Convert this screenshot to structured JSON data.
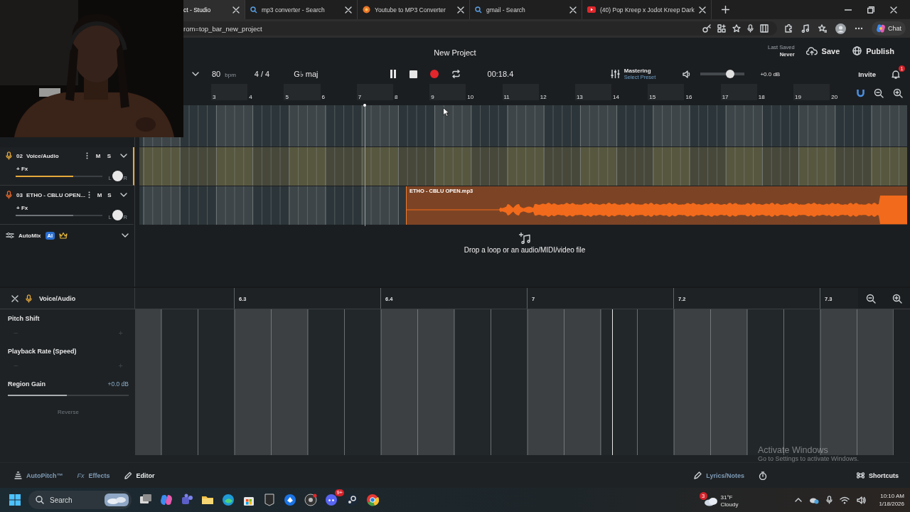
{
  "browser": {
    "tabs": [
      {
        "title": "ct - Studio",
        "selected": true
      },
      {
        "title": "mp3 converter - Search",
        "kind": "search",
        "selected": false
      },
      {
        "title": "Youtube to MP3 Converter",
        "kind": "converter",
        "selected": false
      },
      {
        "title": "gmail - Search",
        "kind": "search",
        "selected": false
      },
      {
        "title": "(40) Pop Kreep x Jodot Kreep Dark",
        "kind": "video",
        "selected": false
      }
    ],
    "address": "rom=top_bar_new_project",
    "chat_button": "Chat"
  },
  "header": {
    "title": "New Project",
    "last_saved_label": "Last Saved",
    "last_saved_value": "Never",
    "save": "Save",
    "publish": "Publish"
  },
  "transport": {
    "tempo": "80",
    "tempo_unit": "bpm",
    "time_signature": "4 / 4",
    "key": "G♭ maj",
    "time": "00:18.4",
    "mastering_title": "Mastering",
    "mastering_preset": "Select Preset",
    "volume": {
      "level": 0.67
    },
    "volume_reading": "+0.0 dB",
    "invite": "Invite",
    "notifications": "1"
  },
  "timeline": {
    "bars": [
      "3",
      "4",
      "5",
      "6",
      "7",
      "8",
      "9",
      "10",
      "11",
      "12",
      "13",
      "14",
      "15",
      "16",
      "17",
      "18",
      "19",
      "20"
    ],
    "lanes": [
      {
        "selected": false
      },
      {
        "selected": true
      },
      {
        "selected": false,
        "clip": {
          "name": "ETHO - CBLU OPEN.mp3"
        }
      }
    ]
  },
  "tracks": [
    {
      "number": "02",
      "name": "Voice/Audio",
      "fx": "+ Fx",
      "mute": "M",
      "solo": "S",
      "pan_left": "L",
      "pan_right": "R",
      "selected": true,
      "color": "#e5a93b",
      "fader": {
        "level": 0.66
      }
    },
    {
      "number": "03",
      "name": "ETHO - CBLU OPEN...",
      "fx": "+ Fx",
      "mute": "M",
      "solo": "S",
      "pan_left": "L",
      "pan_right": "R",
      "selected": false,
      "color": "#ea6a2c",
      "fader": {
        "level": 0.66
      }
    }
  ],
  "automix": {
    "label": "AutoMix",
    "badge": "AI"
  },
  "drop_zone": "Drop a loop or an audio/MIDI/video file",
  "editor": {
    "track_name": "Voice/Audio",
    "ruler": [
      "6.3",
      "6.4",
      "7",
      "7.2",
      "7.3"
    ],
    "params": [
      {
        "kind": "stepper",
        "label": "Pitch Shift",
        "minus": "−",
        "plus": "+",
        "disabled": true
      },
      {
        "kind": "stepper",
        "label": "Playback Rate (Speed)",
        "minus": "−",
        "plus": "+",
        "disabled": true
      },
      {
        "kind": "slider",
        "label": "Region Gain",
        "reading": "+0.0 dB",
        "level": 0.49
      }
    ],
    "reverse": {
      "label": "Reverse",
      "disabled": true
    }
  },
  "bottom_bar": {
    "left": [
      {
        "kind": "autopitch",
        "label": "AutoPitch™",
        "selected": false
      },
      {
        "kind": "fx",
        "prefix": "Fx",
        "label": "Effects",
        "selected": false
      },
      {
        "kind": "pencil",
        "label": "Editor",
        "selected": true
      }
    ],
    "lyrics": "Lyrics/Notes",
    "shortcuts": "Shortcuts"
  },
  "taskbar": {
    "search": "Search",
    "weather_badge": "3",
    "weather_temp": "31°F",
    "weather_text": "Cloudy",
    "app_badge": "9+",
    "time": "10:10 AM",
    "date": "1/18/2026"
  },
  "activation": {
    "title": "Activate Windows",
    "text": "Go to Settings to activate Windows."
  }
}
